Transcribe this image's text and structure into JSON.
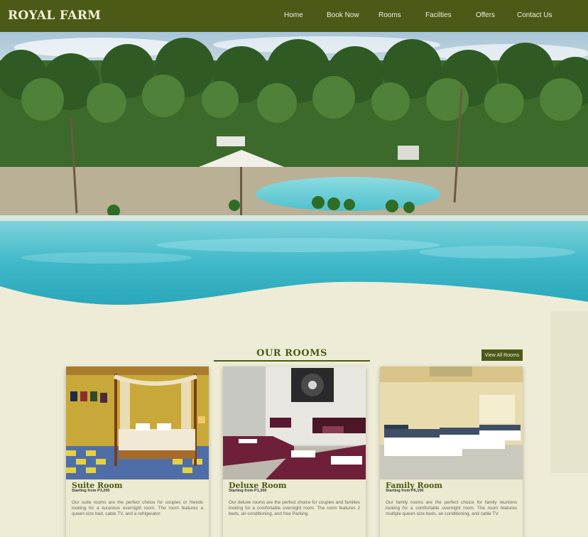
{
  "brand": "ROYAL FARM",
  "nav": {
    "home": "Home",
    "book_now": "Book Now",
    "rooms": "Rooms",
    "facilities": "Facilties",
    "offers": "Offers",
    "contact_us": "Contact Us"
  },
  "section": {
    "title": "OUR ROOMS",
    "view_all_label": "View All Rooms"
  },
  "rooms": [
    {
      "name": "Suite Room",
      "price": "Starting from P3,200",
      "description": "Our suite rooms are the perfect choice for couples or friends looking for a luxurious overnight room. The room features a queen-size bed, cable TV, and a refrigerator."
    },
    {
      "name": "Deluxe Room",
      "price": "Starting from P1,300",
      "description": "Our deluxe rooms are the perfect choice for couples and families looking for a comfortable overnight room. The room features 2 beds, air-conditioning, and free Parking."
    },
    {
      "name": "Family Room",
      "price": "Starting from P6,100",
      "description": "Our family rooms are the perfect choice for family reunions looking for a comfortable overnight room. The room features multiple queen-size beds, air-conditioning, and cable TV."
    }
  ],
  "colors": {
    "primary": "#4c5a18",
    "background": "#eeecd6",
    "pool": "#5cc6d3"
  }
}
